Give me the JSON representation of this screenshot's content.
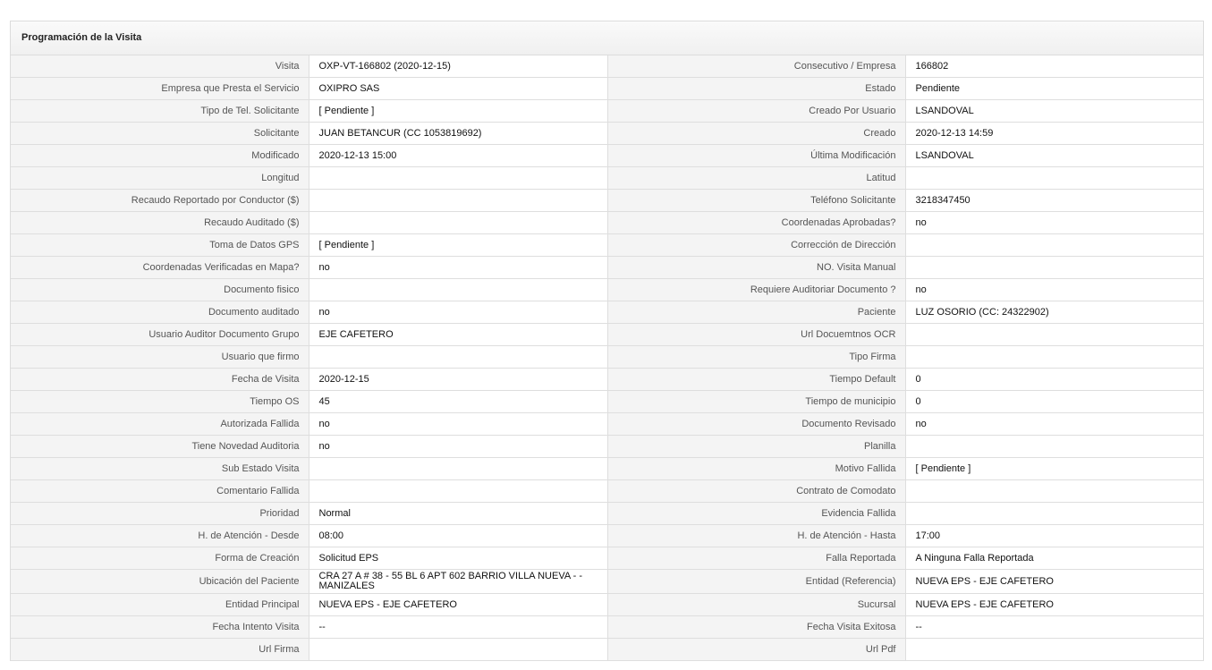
{
  "panel": {
    "title": "Programación de la Visita"
  },
  "rows": [
    [
      {
        "label": "Visita",
        "value": "OXP-VT-166802 (2020-12-15)"
      },
      {
        "label": "Consecutivo / Empresa",
        "value": "166802"
      }
    ],
    [
      {
        "label": "Empresa que Presta el Servicio",
        "value": "OXIPRO SAS"
      },
      {
        "label": "Estado",
        "value": "Pendiente"
      }
    ],
    [
      {
        "label": "Tipo de Tel. Solicitante",
        "value": "[ Pendiente ]"
      },
      {
        "label": "Creado Por Usuario",
        "value": "LSANDOVAL"
      }
    ],
    [
      {
        "label": "Solicitante",
        "value": "JUAN BETANCUR (CC 1053819692)"
      },
      {
        "label": "Creado",
        "value": "2020-12-13 14:59"
      }
    ],
    [
      {
        "label": "Modificado",
        "value": "2020-12-13 15:00"
      },
      {
        "label": "Última Modificación",
        "value": " LSANDOVAL"
      }
    ],
    [
      {
        "label": "Longitud",
        "value": ""
      },
      {
        "label": "Latitud",
        "value": ""
      }
    ],
    [
      {
        "label": "Recaudo Reportado por Conductor ($)",
        "value": ""
      },
      {
        "label": "Teléfono Solicitante",
        "value": "3218347450"
      }
    ],
    [
      {
        "label": "Recaudo Auditado ($)",
        "value": ""
      },
      {
        "label": "Coordenadas Aprobadas?",
        "value": " no"
      }
    ],
    [
      {
        "label": "Toma de Datos GPS",
        "value": "[ Pendiente ]"
      },
      {
        "label": "Corrección de Dirección",
        "value": ""
      }
    ],
    [
      {
        "label": "Coordenadas Verificadas en Mapa?",
        "value": " no"
      },
      {
        "label": "NO. Visita Manual",
        "value": ""
      }
    ],
    [
      {
        "label": "Documento fisico",
        "value": ""
      },
      {
        "label": "Requiere Auditoriar Documento ?",
        "value": " no"
      }
    ],
    [
      {
        "label": "Documento auditado",
        "value": " no"
      },
      {
        "label": "Paciente",
        "value": "LUZ OSORIO (CC: 24322902)"
      }
    ],
    [
      {
        "label": "Usuario Auditor Documento Grupo",
        "value": "EJE CAFETERO"
      },
      {
        "label": "Url Docuemtnos OCR",
        "value": ""
      }
    ],
    [
      {
        "label": "Usuario que firmo",
        "value": ""
      },
      {
        "label": "Tipo Firma",
        "value": ""
      }
    ],
    [
      {
        "label": "Fecha de Visita",
        "value": " 2020-12-15"
      },
      {
        "label": "Tiempo Default",
        "value": "0"
      }
    ],
    [
      {
        "label": "Tiempo OS",
        "value": "45"
      },
      {
        "label": "Tiempo de municipio",
        "value": "0"
      }
    ],
    [
      {
        "label": "Autorizada Fallida",
        "value": " no"
      },
      {
        "label": "Documento Revisado",
        "value": " no"
      }
    ],
    [
      {
        "label": "Tiene Novedad Auditoria",
        "value": " no"
      },
      {
        "label": "Planilla",
        "value": ""
      }
    ],
    [
      {
        "label": "Sub Estado Visita",
        "value": ""
      },
      {
        "label": "Motivo Fallida",
        "value": "[ Pendiente ]"
      }
    ],
    [
      {
        "label": "Comentario Fallida",
        "value": ""
      },
      {
        "label": "Contrato de Comodato",
        "value": ""
      }
    ],
    [
      {
        "label": "Prioridad",
        "value": "Normal"
      },
      {
        "label": "Evidencia Fallida",
        "value": ""
      }
    ],
    [
      {
        "label": "H. de Atención - Desde",
        "value": "08:00"
      },
      {
        "label": "H. de Atención - Hasta",
        "value": "17:00"
      }
    ],
    [
      {
        "label": "Forma de Creación",
        "value": "Solicitud EPS"
      },
      {
        "label": "Falla Reportada",
        "value": "A Ninguna Falla Reportada"
      }
    ],
    [
      {
        "label": "Ubicación del Paciente",
        "value": "CRA 27 A # 38 - 55 BL 6 APT 602 BARRIO VILLA NUEVA - - MANIZALES"
      },
      {
        "label": "Entidad (Referencia)",
        "value": "NUEVA EPS - EJE CAFETERO"
      }
    ],
    [
      {
        "label": "Entidad Principal",
        "value": "NUEVA EPS - EJE CAFETERO"
      },
      {
        "label": "Sucursal",
        "value": "NUEVA EPS - EJE CAFETERO"
      }
    ],
    [
      {
        "label": "Fecha Intento Visita",
        "value": " --"
      },
      {
        "label": "Fecha Visita Exitosa",
        "value": " --"
      }
    ],
    [
      {
        "label": "Url Firma",
        "value": ""
      },
      {
        "label": "Url Pdf",
        "value": ""
      }
    ]
  ]
}
